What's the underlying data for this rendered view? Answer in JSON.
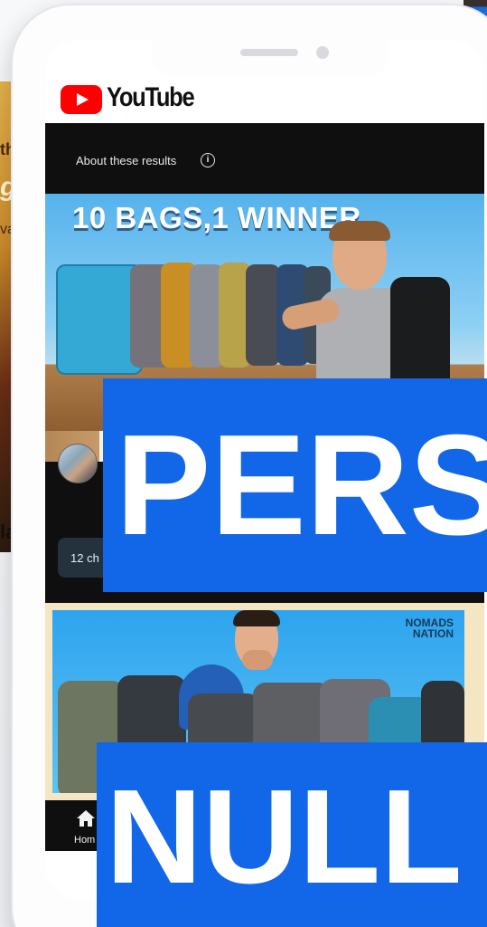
{
  "background": {
    "left_fragment_1": "th",
    "left_fragment_2": "g",
    "left_fragment_3": "va",
    "left_caption_fragment": "la"
  },
  "app": {
    "brand": "YouTube",
    "brand_color": "#ff0000"
  },
  "results_notice": {
    "label": "About these results",
    "icon": "info-icon"
  },
  "videos": [
    {
      "thumbnail_text": "10 BAGS,1 WINNER",
      "chip_label": "12 ch"
    },
    {
      "thumbnail_badge_line1": "NOMADS",
      "thumbnail_badge_line2": "NATION"
    }
  ],
  "bottom_nav": {
    "home_label": "Hom",
    "home_icon": "home-icon"
  },
  "overlays": {
    "top_label": "PERSO",
    "bottom_label": "NULL",
    "color": "#1266e8"
  }
}
